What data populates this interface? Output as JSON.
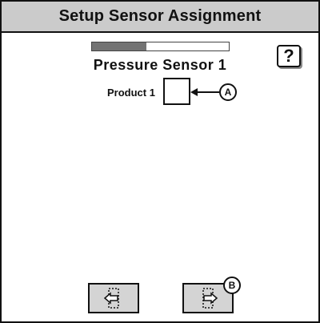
{
  "header": {
    "title": "Setup Sensor Assignment"
  },
  "progress": {
    "fraction": 0.4
  },
  "help_button": {
    "label": "?"
  },
  "sensor": {
    "title": "Pressure Sensor 1"
  },
  "product": {
    "label": "Product 1",
    "checked": false
  },
  "callouts": {
    "a": "A",
    "b": "B"
  },
  "nav": {
    "back_icon": "back-arrow-icon",
    "next_icon": "next-arrow-icon"
  }
}
